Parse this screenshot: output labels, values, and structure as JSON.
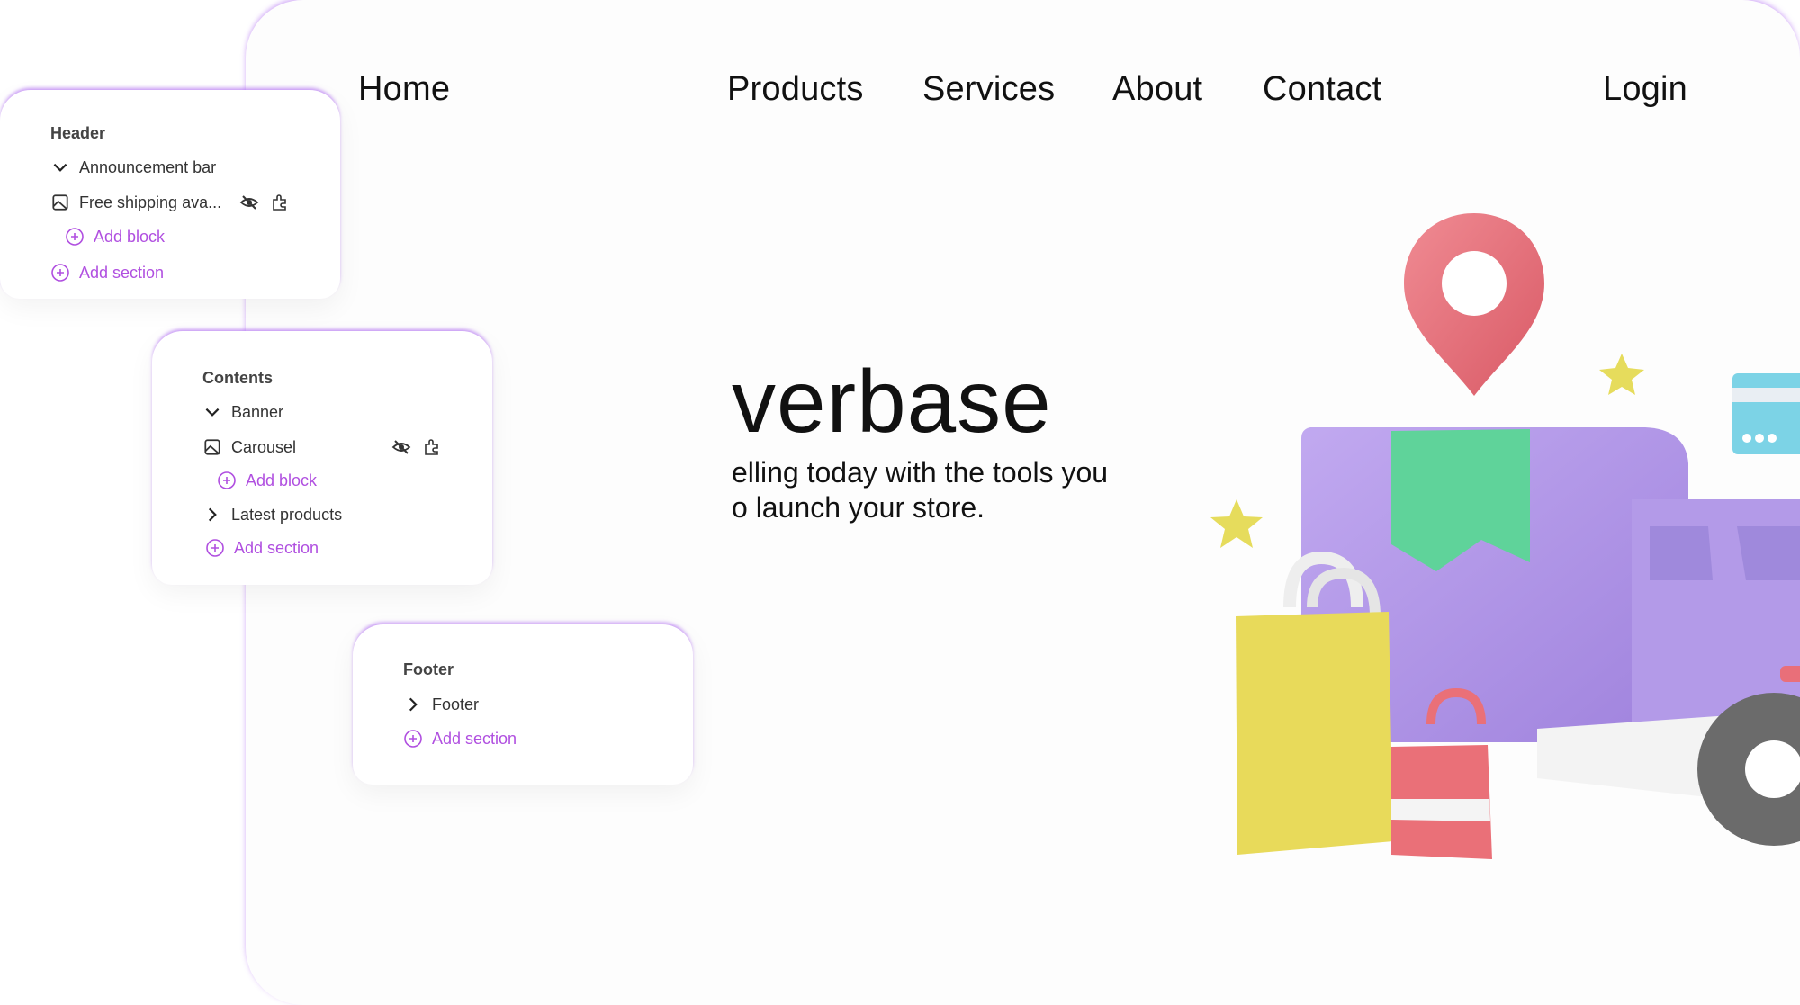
{
  "nav": {
    "home": "Home",
    "products": "Products",
    "services": "Services",
    "about": "About",
    "contact": "Contact",
    "login": "Login"
  },
  "hero": {
    "title": "verbase",
    "subtitle_line1": "elling today with the tools you",
    "subtitle_line2": "o launch your store."
  },
  "header_panel": {
    "title": "Header",
    "section": "Announcement bar",
    "block": "Free shipping ava...",
    "add_block": "Add block",
    "add_section": "Add section"
  },
  "contents_panel": {
    "title": "Contents",
    "section1": "Banner",
    "block": "Carousel",
    "add_block": "Add block",
    "section2": "Latest products",
    "add_section": "Add section"
  },
  "footer_panel": {
    "title": "Footer",
    "section": "Footer",
    "add_section": "Add section"
  },
  "colors": {
    "accent": "#b04fe0",
    "frame_glow": "#b06ef2",
    "truck": "#b39ae8",
    "pin": "#e96f79",
    "ribbon": "#5fd39a",
    "bag_yellow": "#e8da5a",
    "bag_red": "#ea7078",
    "card": "#7cd3e6",
    "star": "#e6dc5c"
  }
}
